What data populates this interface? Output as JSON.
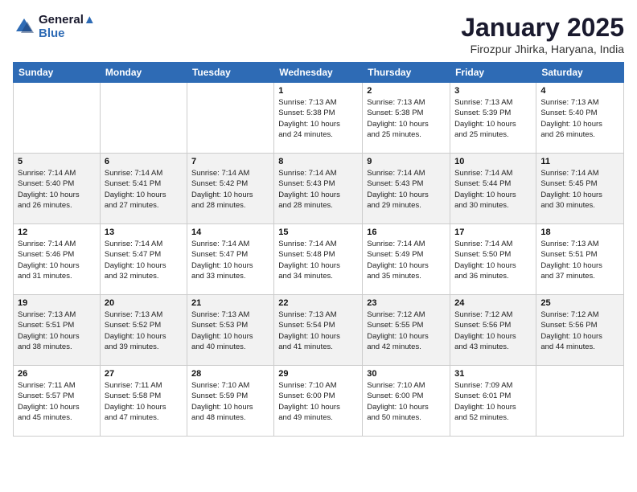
{
  "header": {
    "logo_line1": "General",
    "logo_line2": "Blue",
    "month": "January 2025",
    "location": "Firozpur Jhirka, Haryana, India"
  },
  "days_of_week": [
    "Sunday",
    "Monday",
    "Tuesday",
    "Wednesday",
    "Thursday",
    "Friday",
    "Saturday"
  ],
  "weeks": [
    [
      {
        "day": "",
        "info": ""
      },
      {
        "day": "",
        "info": ""
      },
      {
        "day": "",
        "info": ""
      },
      {
        "day": "1",
        "info": "Sunrise: 7:13 AM\nSunset: 5:38 PM\nDaylight: 10 hours\nand 24 minutes."
      },
      {
        "day": "2",
        "info": "Sunrise: 7:13 AM\nSunset: 5:38 PM\nDaylight: 10 hours\nand 25 minutes."
      },
      {
        "day": "3",
        "info": "Sunrise: 7:13 AM\nSunset: 5:39 PM\nDaylight: 10 hours\nand 25 minutes."
      },
      {
        "day": "4",
        "info": "Sunrise: 7:13 AM\nSunset: 5:40 PM\nDaylight: 10 hours\nand 26 minutes."
      }
    ],
    [
      {
        "day": "5",
        "info": "Sunrise: 7:14 AM\nSunset: 5:40 PM\nDaylight: 10 hours\nand 26 minutes."
      },
      {
        "day": "6",
        "info": "Sunrise: 7:14 AM\nSunset: 5:41 PM\nDaylight: 10 hours\nand 27 minutes."
      },
      {
        "day": "7",
        "info": "Sunrise: 7:14 AM\nSunset: 5:42 PM\nDaylight: 10 hours\nand 28 minutes."
      },
      {
        "day": "8",
        "info": "Sunrise: 7:14 AM\nSunset: 5:43 PM\nDaylight: 10 hours\nand 28 minutes."
      },
      {
        "day": "9",
        "info": "Sunrise: 7:14 AM\nSunset: 5:43 PM\nDaylight: 10 hours\nand 29 minutes."
      },
      {
        "day": "10",
        "info": "Sunrise: 7:14 AM\nSunset: 5:44 PM\nDaylight: 10 hours\nand 30 minutes."
      },
      {
        "day": "11",
        "info": "Sunrise: 7:14 AM\nSunset: 5:45 PM\nDaylight: 10 hours\nand 30 minutes."
      }
    ],
    [
      {
        "day": "12",
        "info": "Sunrise: 7:14 AM\nSunset: 5:46 PM\nDaylight: 10 hours\nand 31 minutes."
      },
      {
        "day": "13",
        "info": "Sunrise: 7:14 AM\nSunset: 5:47 PM\nDaylight: 10 hours\nand 32 minutes."
      },
      {
        "day": "14",
        "info": "Sunrise: 7:14 AM\nSunset: 5:47 PM\nDaylight: 10 hours\nand 33 minutes."
      },
      {
        "day": "15",
        "info": "Sunrise: 7:14 AM\nSunset: 5:48 PM\nDaylight: 10 hours\nand 34 minutes."
      },
      {
        "day": "16",
        "info": "Sunrise: 7:14 AM\nSunset: 5:49 PM\nDaylight: 10 hours\nand 35 minutes."
      },
      {
        "day": "17",
        "info": "Sunrise: 7:14 AM\nSunset: 5:50 PM\nDaylight: 10 hours\nand 36 minutes."
      },
      {
        "day": "18",
        "info": "Sunrise: 7:13 AM\nSunset: 5:51 PM\nDaylight: 10 hours\nand 37 minutes."
      }
    ],
    [
      {
        "day": "19",
        "info": "Sunrise: 7:13 AM\nSunset: 5:51 PM\nDaylight: 10 hours\nand 38 minutes."
      },
      {
        "day": "20",
        "info": "Sunrise: 7:13 AM\nSunset: 5:52 PM\nDaylight: 10 hours\nand 39 minutes."
      },
      {
        "day": "21",
        "info": "Sunrise: 7:13 AM\nSunset: 5:53 PM\nDaylight: 10 hours\nand 40 minutes."
      },
      {
        "day": "22",
        "info": "Sunrise: 7:13 AM\nSunset: 5:54 PM\nDaylight: 10 hours\nand 41 minutes."
      },
      {
        "day": "23",
        "info": "Sunrise: 7:12 AM\nSunset: 5:55 PM\nDaylight: 10 hours\nand 42 minutes."
      },
      {
        "day": "24",
        "info": "Sunrise: 7:12 AM\nSunset: 5:56 PM\nDaylight: 10 hours\nand 43 minutes."
      },
      {
        "day": "25",
        "info": "Sunrise: 7:12 AM\nSunset: 5:56 PM\nDaylight: 10 hours\nand 44 minutes."
      }
    ],
    [
      {
        "day": "26",
        "info": "Sunrise: 7:11 AM\nSunset: 5:57 PM\nDaylight: 10 hours\nand 45 minutes."
      },
      {
        "day": "27",
        "info": "Sunrise: 7:11 AM\nSunset: 5:58 PM\nDaylight: 10 hours\nand 47 minutes."
      },
      {
        "day": "28",
        "info": "Sunrise: 7:10 AM\nSunset: 5:59 PM\nDaylight: 10 hours\nand 48 minutes."
      },
      {
        "day": "29",
        "info": "Sunrise: 7:10 AM\nSunset: 6:00 PM\nDaylight: 10 hours\nand 49 minutes."
      },
      {
        "day": "30",
        "info": "Sunrise: 7:10 AM\nSunset: 6:00 PM\nDaylight: 10 hours\nand 50 minutes."
      },
      {
        "day": "31",
        "info": "Sunrise: 7:09 AM\nSunset: 6:01 PM\nDaylight: 10 hours\nand 52 minutes."
      },
      {
        "day": "",
        "info": ""
      }
    ]
  ]
}
